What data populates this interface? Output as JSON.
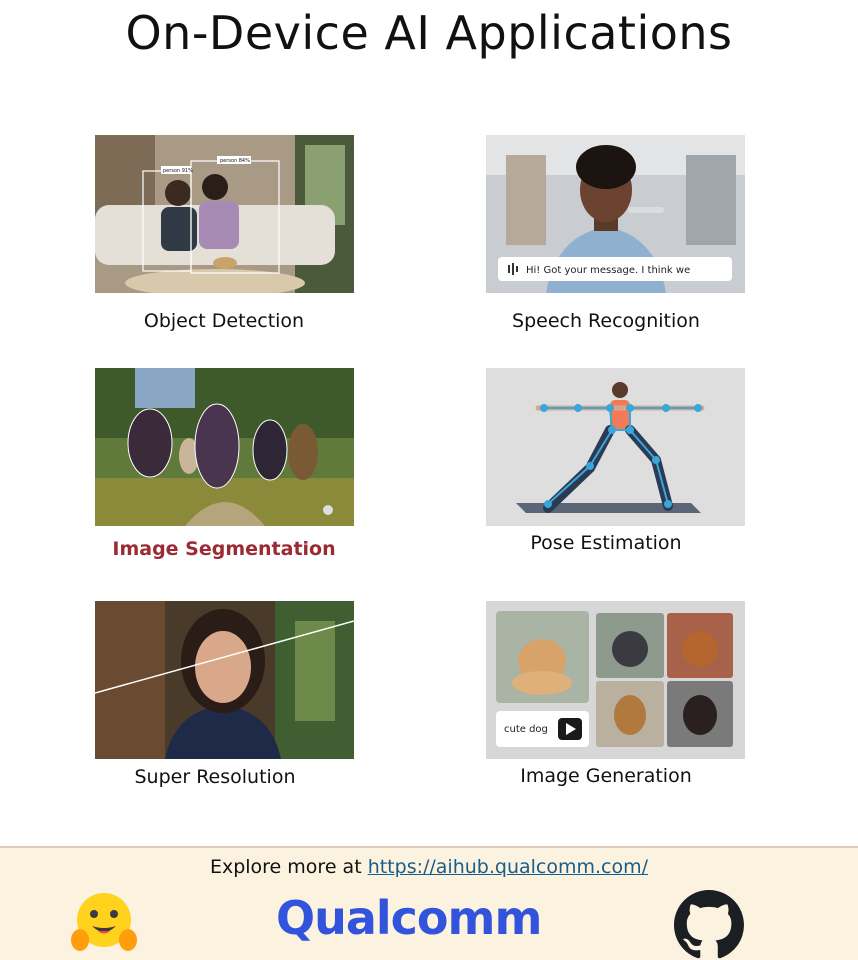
{
  "title": "On-Device AI Applications",
  "applications": [
    {
      "label": "Object Detection",
      "detections": [
        "person 91%",
        "person 84%"
      ]
    },
    {
      "label": "Speech Recognition",
      "transcript": "Hi! Got your message. I think we"
    },
    {
      "label": "Image Segmentation"
    },
    {
      "label": "Pose Estimation"
    },
    {
      "label": "Super Resolution"
    },
    {
      "label": "Image Generation",
      "prompt": "cute dog"
    }
  ],
  "footer": {
    "explore_text": "Explore more at",
    "link": "https://aihub.qualcomm.com/",
    "brand": "Qualcomm",
    "icons": [
      "hugging-face-icon",
      "github-icon"
    ]
  },
  "colors": {
    "active_label": "#9b2a33",
    "brand_blue": "#3253dc",
    "footer_bg": "#fbf3df",
    "link": "#1a5c8a"
  }
}
